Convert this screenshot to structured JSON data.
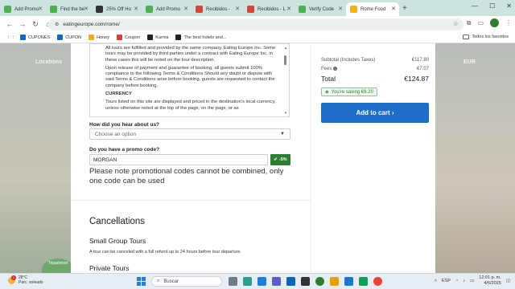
{
  "browser": {
    "tabs": [
      {
        "label": "Add Promo",
        "color": "#4caf50"
      },
      {
        "label": "Find the be",
        "color": "#4caf50"
      },
      {
        "label": "25% Off Ho",
        "color": "#333333"
      },
      {
        "label": "Add Promo",
        "color": "#4caf50"
      },
      {
        "label": "Recibidos -",
        "color": "#d44638"
      },
      {
        "label": "Recibidos - L",
        "color": "#d44638"
      },
      {
        "label": "Verify Code",
        "color": "#4caf50"
      },
      {
        "label": "Rome Food",
        "color": "#f5b400",
        "active": true
      }
    ],
    "new_tab": "+",
    "url": "eatingeurope.com/rome/",
    "bookmarks": [
      {
        "label": "CUPONES",
        "color": "#1565c0"
      },
      {
        "label": "CUPON",
        "color": "#1565c0"
      },
      {
        "label": "Honey",
        "color": "#f5a623"
      },
      {
        "label": "Coupon",
        "color": "#e53935"
      },
      {
        "label": "Karma",
        "color": "#222222"
      },
      {
        "label": "The best hotels and...",
        "color": "#222222"
      }
    ],
    "all_bookmarks": "Todos los favoritos"
  },
  "page_bg": {
    "locations": "Locations",
    "currency": "EUR",
    "tripadvisor": "Tripadvisor"
  },
  "terms": {
    "p1": "All tours are fulfilled and provided by the same company, Eating Europe Inc. Some tours may be provided by third parties under a contract with Eating Europe Inc. in these cases this will be noted on the tour description.",
    "p2": "Upon release of payment and guarantee of booking, all guests submit 100% compliance to the following Terms & Conditions Should any doubt or dispute with said Terms & Conditions arise before booking, guests are requested to contact the company before booking.",
    "heading": "CURRENCY",
    "p3": "Tours listed on this site are displayed and priced in the destination's local currency, unless otherwise noted at the top of the page, on the page, or as"
  },
  "form": {
    "hear_label": "How did you hear about us?",
    "hear_value": "Choose an option",
    "promo_label": "Do you have a promo code?",
    "promo_value": "MORGAN",
    "promo_badge": "-5%",
    "promo_note": "Please note promotional codes cannot be combined, only one code can be used"
  },
  "cancellations": {
    "title": "Cancellations",
    "small_group": "Small Group Tours",
    "small_group_text": "A tour can be canceled with a full refund up to 24 hours before tour departure.",
    "private": "Private Tours"
  },
  "summary": {
    "subtotal_label": "Subtotal (Includes Taxes)",
    "subtotal_value": "€117.80",
    "fees_label": "Fees",
    "fees_value": "€7.07",
    "total_label": "Total",
    "total_value": "€124.87",
    "saving": "You're saving €6.20",
    "cart_button": "Add to cart ›"
  },
  "taskbar": {
    "temp": "28°C",
    "weather": "Parc. soleado",
    "weather_badge": "1",
    "search": "Buscar",
    "lang": "ESP",
    "time": "12:01 p. m.",
    "date": "4/6/2025"
  }
}
